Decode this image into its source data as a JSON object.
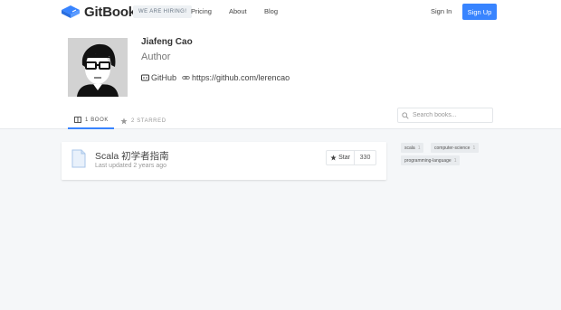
{
  "nav": {
    "brand": "GitBook",
    "hiring_badge": "WE ARE HIRING!",
    "links": [
      "Pricing",
      "About",
      "Blog"
    ],
    "sign_in": "Sign In",
    "sign_up": "Sign Up"
  },
  "profile": {
    "name": "Jiafeng Cao",
    "role": "Author",
    "github_label": "GitHub",
    "website": "https://github.com/lerencao"
  },
  "tabs": {
    "books": "1 BOOK",
    "starred": "2 STARRED"
  },
  "search": {
    "placeholder": "Search books..."
  },
  "books": [
    {
      "title": "Scala 初学者指南",
      "updated": "Last updated 2 years ago",
      "star_label": "Star",
      "star_count": "330"
    }
  ],
  "tags": [
    {
      "name": "scala",
      "count": "1"
    },
    {
      "name": "computer-science",
      "count": "1"
    },
    {
      "name": "programming-language",
      "count": "1"
    }
  ],
  "colors": {
    "accent": "#3884ff",
    "background": "#f5f7f9"
  }
}
